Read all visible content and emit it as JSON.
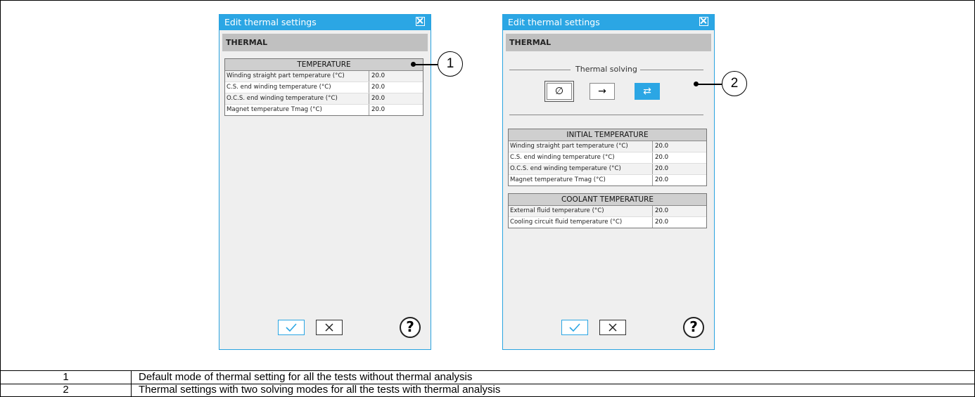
{
  "dialog1": {
    "title": "Edit thermal settings",
    "section": "THERMAL",
    "table": {
      "header": "TEMPERATURE",
      "rows": [
        {
          "label": "Winding straight part temperature (°C)",
          "value": "20.0"
        },
        {
          "label": "C.S. end winding temperature (°C)",
          "value": "20.0"
        },
        {
          "label": "O.C.S. end winding temperature (°C)",
          "value": "20.0"
        },
        {
          "label": "Magnet temperature Tmag (°C)",
          "value": "20.0"
        }
      ]
    },
    "help": "?"
  },
  "dialog2": {
    "title": "Edit thermal settings",
    "section": "THERMAL",
    "solving_label": "Thermal solving",
    "solving_buttons": [
      {
        "glyph": "∅",
        "icon": "none-icon"
      },
      {
        "glyph": "→",
        "icon": "one-way-arrow-icon"
      },
      {
        "glyph": "⇄",
        "icon": "two-way-arrows-icon"
      }
    ],
    "initial_table": {
      "header": "INITIAL TEMPERATURE",
      "rows": [
        {
          "label": "Winding straight part temperature (°C)",
          "value": "20.0"
        },
        {
          "label": "C.S. end winding temperature (°C)",
          "value": "20.0"
        },
        {
          "label": "O.C.S. end winding temperature (°C)",
          "value": "20.0"
        },
        {
          "label": "Magnet temperature Tmag (°C)",
          "value": "20.0"
        }
      ]
    },
    "coolant_table": {
      "header": "COOLANT TEMPERATURE",
      "rows": [
        {
          "label": "External fluid temperature (°C)",
          "value": "20.0"
        },
        {
          "label": "Cooling circuit fluid temperature (°C)",
          "value": "20.0"
        }
      ]
    },
    "help": "?"
  },
  "callouts": [
    "1",
    "2"
  ],
  "legend": [
    {
      "num": "1",
      "text": "Default mode of thermal setting for all the tests without thermal analysis"
    },
    {
      "num": "2",
      "text": "Thermal settings with two solving modes for all the tests with thermal analysis"
    }
  ],
  "colors": {
    "accent": "#2ba6e4",
    "panel": "#efefef",
    "section": "#c0c0c0"
  }
}
